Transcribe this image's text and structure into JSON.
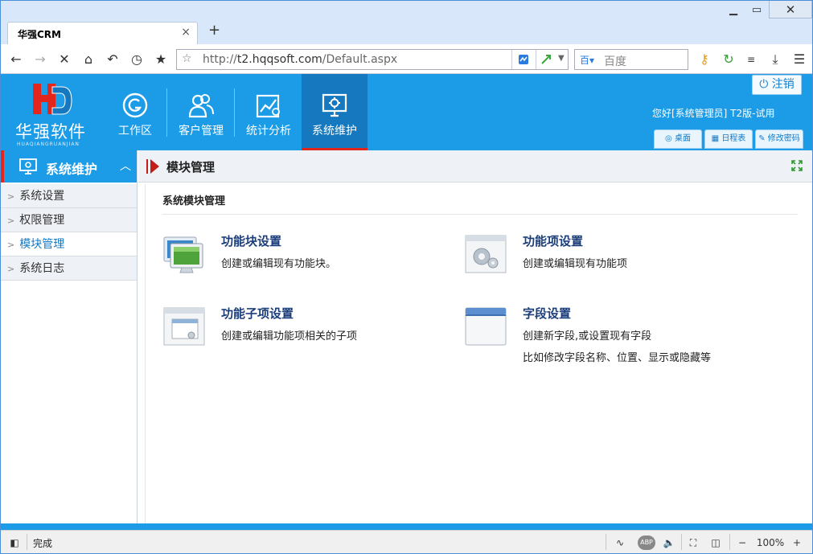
{
  "browser": {
    "tab_title": "华强CRM",
    "tab_close": "×",
    "new_tab": "+",
    "url_prefix": "http://",
    "url_host": "t2.hqqsoft.com",
    "url_path": "/Default.aspx",
    "search_engine_icon": "百",
    "search_placeholder": "百度",
    "window_buttons": {
      "minimize": "▁",
      "maximize": "▭",
      "close": "✕"
    }
  },
  "app": {
    "logo_text": "华强软件",
    "logo_pinyin": "HUAQIANGRUANJIAN",
    "modules": [
      {
        "label": "工作区",
        "icon": "workspace-icon"
      },
      {
        "label": "客户管理",
        "icon": "customers-icon"
      },
      {
        "label": "统计分析",
        "icon": "statistics-icon"
      },
      {
        "label": "系统维护",
        "icon": "system-maintenance-icon"
      }
    ],
    "logout_label": "注销",
    "greeting": "您好[系统管理员] T2版-试用",
    "header_buttons": [
      {
        "label": "桌面",
        "icon": "desktop-icon"
      },
      {
        "label": "日程表",
        "icon": "calendar-icon"
      },
      {
        "label": "修改密码",
        "icon": "edit-password-icon"
      }
    ]
  },
  "sidebar": {
    "title": "系统维护",
    "items": [
      {
        "label": "系统设置",
        "active": false
      },
      {
        "label": "权限管理",
        "active": false
      },
      {
        "label": "模块管理",
        "active": true
      },
      {
        "label": "系统日志",
        "active": false
      }
    ]
  },
  "content": {
    "header_title": "模块管理",
    "panel_title": "系统模块管理",
    "items": [
      {
        "name": "功能块设置",
        "desc": [
          "创建或编辑现有功能块。"
        ],
        "icon": "monitor-icon"
      },
      {
        "name": "功能项设置",
        "desc": [
          "创建或编辑现有功能项"
        ],
        "icon": "gear-window-icon"
      },
      {
        "name": "功能子项设置",
        "desc": [
          "创建或编辑功能项相关的子项"
        ],
        "icon": "subwindow-icon"
      },
      {
        "name": "字段设置",
        "desc": [
          "创建新字段,或设置现有字段",
          "比如修改字段名称、位置、显示或隐藏等"
        ],
        "icon": "field-window-icon"
      }
    ]
  },
  "statusbar": {
    "status_text": "完成",
    "zoom": "100%",
    "zoom_minus": "−",
    "zoom_plus": "+",
    "abp": "ABP"
  },
  "colors": {
    "header_blue": "#1c9be6",
    "active_blue": "#1679bf",
    "accent_red": "#e2261c",
    "link_navy": "#1b3e7a"
  }
}
